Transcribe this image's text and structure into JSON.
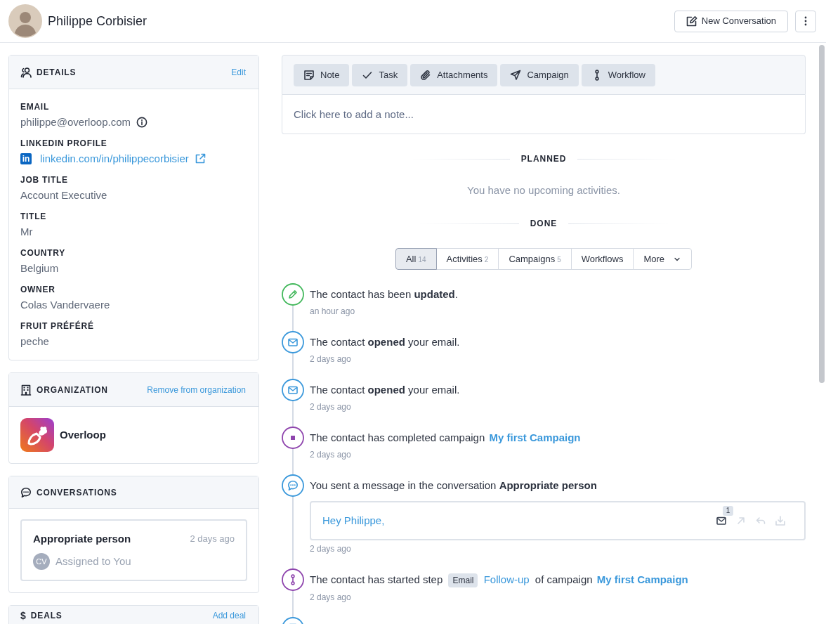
{
  "header": {
    "name": "Philippe Corbisier",
    "new_conversation": "New Conversation"
  },
  "details": {
    "title": "DETAILS",
    "action": "Edit",
    "fields": [
      {
        "kind": "email",
        "label": "EMAIL",
        "value": "philippe@overloop.com"
      },
      {
        "kind": "linkedin",
        "label": "LINKEDIN PROFILE",
        "logo": "in",
        "value": "linkedin.com/in/philippecorbisier"
      },
      {
        "kind": "text",
        "label": "JOB TITLE",
        "value": "Account Executive"
      },
      {
        "kind": "text",
        "label": "TITLE",
        "value": "Mr"
      },
      {
        "kind": "text",
        "label": "COUNTRY",
        "value": "Belgium"
      },
      {
        "kind": "text",
        "label": "OWNER",
        "value": "Colas Vandervaere"
      },
      {
        "kind": "text",
        "label": "FRUIT PRÉFÉRÉ",
        "value": "peche"
      }
    ]
  },
  "organization": {
    "title": "ORGANIZATION",
    "action": "Remove from organization",
    "name": "Overloop"
  },
  "conversations": {
    "title": "CONVERSATIONS",
    "items": [
      {
        "subject": "Appropriate person",
        "time": "2 days ago",
        "initials": "CV",
        "assignee": "Assigned to You"
      }
    ]
  },
  "deals": {
    "icon": "$",
    "title": "DEALS",
    "action": "Add deal"
  },
  "composer": {
    "tools": [
      {
        "kind": "note",
        "label": "Note"
      },
      {
        "kind": "task",
        "label": "Task"
      },
      {
        "kind": "attachments",
        "label": "Attachments"
      },
      {
        "kind": "campaign",
        "label": "Campaign"
      },
      {
        "kind": "workflow",
        "label": "Workflow"
      }
    ],
    "placeholder": "Click here to add a note..."
  },
  "planned": {
    "title": "PLANNED",
    "empty": "You have no upcoming activities."
  },
  "done": {
    "title": "DONE",
    "filters": [
      {
        "kind": "filter",
        "label": "All",
        "count": "14",
        "selected": true
      },
      {
        "kind": "filter",
        "label": "Activities",
        "count": "2",
        "selected": false
      },
      {
        "kind": "filter",
        "label": "Campaigns",
        "count": "5",
        "selected": false
      },
      {
        "kind": "filter",
        "label": "Workflows",
        "selected": false
      },
      {
        "kind": "menu",
        "label": "More",
        "selected": false
      }
    ]
  },
  "timeline": [
    {
      "kind": "update",
      "parts": [
        {
          "kind": "text",
          "text": "The contact has been **updated**."
        }
      ],
      "time": "an hour ago"
    },
    {
      "kind": "email_open",
      "parts": [
        {
          "kind": "text",
          "text": "The contact **opened** your email."
        }
      ],
      "time": "2 days ago"
    },
    {
      "kind": "email_open",
      "parts": [
        {
          "kind": "text",
          "text": "The contact **opened** your email."
        }
      ],
      "time": "2 days ago"
    },
    {
      "kind": "campaign_done",
      "parts": [
        {
          "kind": "text",
          "text": "The contact has completed campaign"
        },
        {
          "kind": "strong_link",
          "text": "My first Campaign"
        }
      ],
      "time": "2 days ago"
    },
    {
      "kind": "message",
      "parts": [
        {
          "kind": "text",
          "text": "You sent a message in the conversation **Appropriate person**"
        }
      ],
      "message": {
        "preview": "Hey Philippe,",
        "actions": [
          {
            "kind": "mail",
            "count": "1",
            "disabled": false
          },
          {
            "kind": "forward",
            "disabled": true
          },
          {
            "kind": "reply",
            "disabled": true
          },
          {
            "kind": "archive",
            "disabled": true
          }
        ]
      },
      "time": "2 days ago"
    },
    {
      "kind": "workflow_step",
      "parts": [
        {
          "kind": "text",
          "text": "The contact has started step"
        },
        {
          "kind": "tag",
          "text": "Email"
        },
        {
          "kind": "link",
          "text": "Follow-up"
        },
        {
          "kind": "text",
          "text": "of campaign"
        },
        {
          "kind": "strong_link",
          "text": "My first Campaign"
        }
      ],
      "time": "2 days ago"
    },
    {
      "kind": "partial"
    }
  ]
}
